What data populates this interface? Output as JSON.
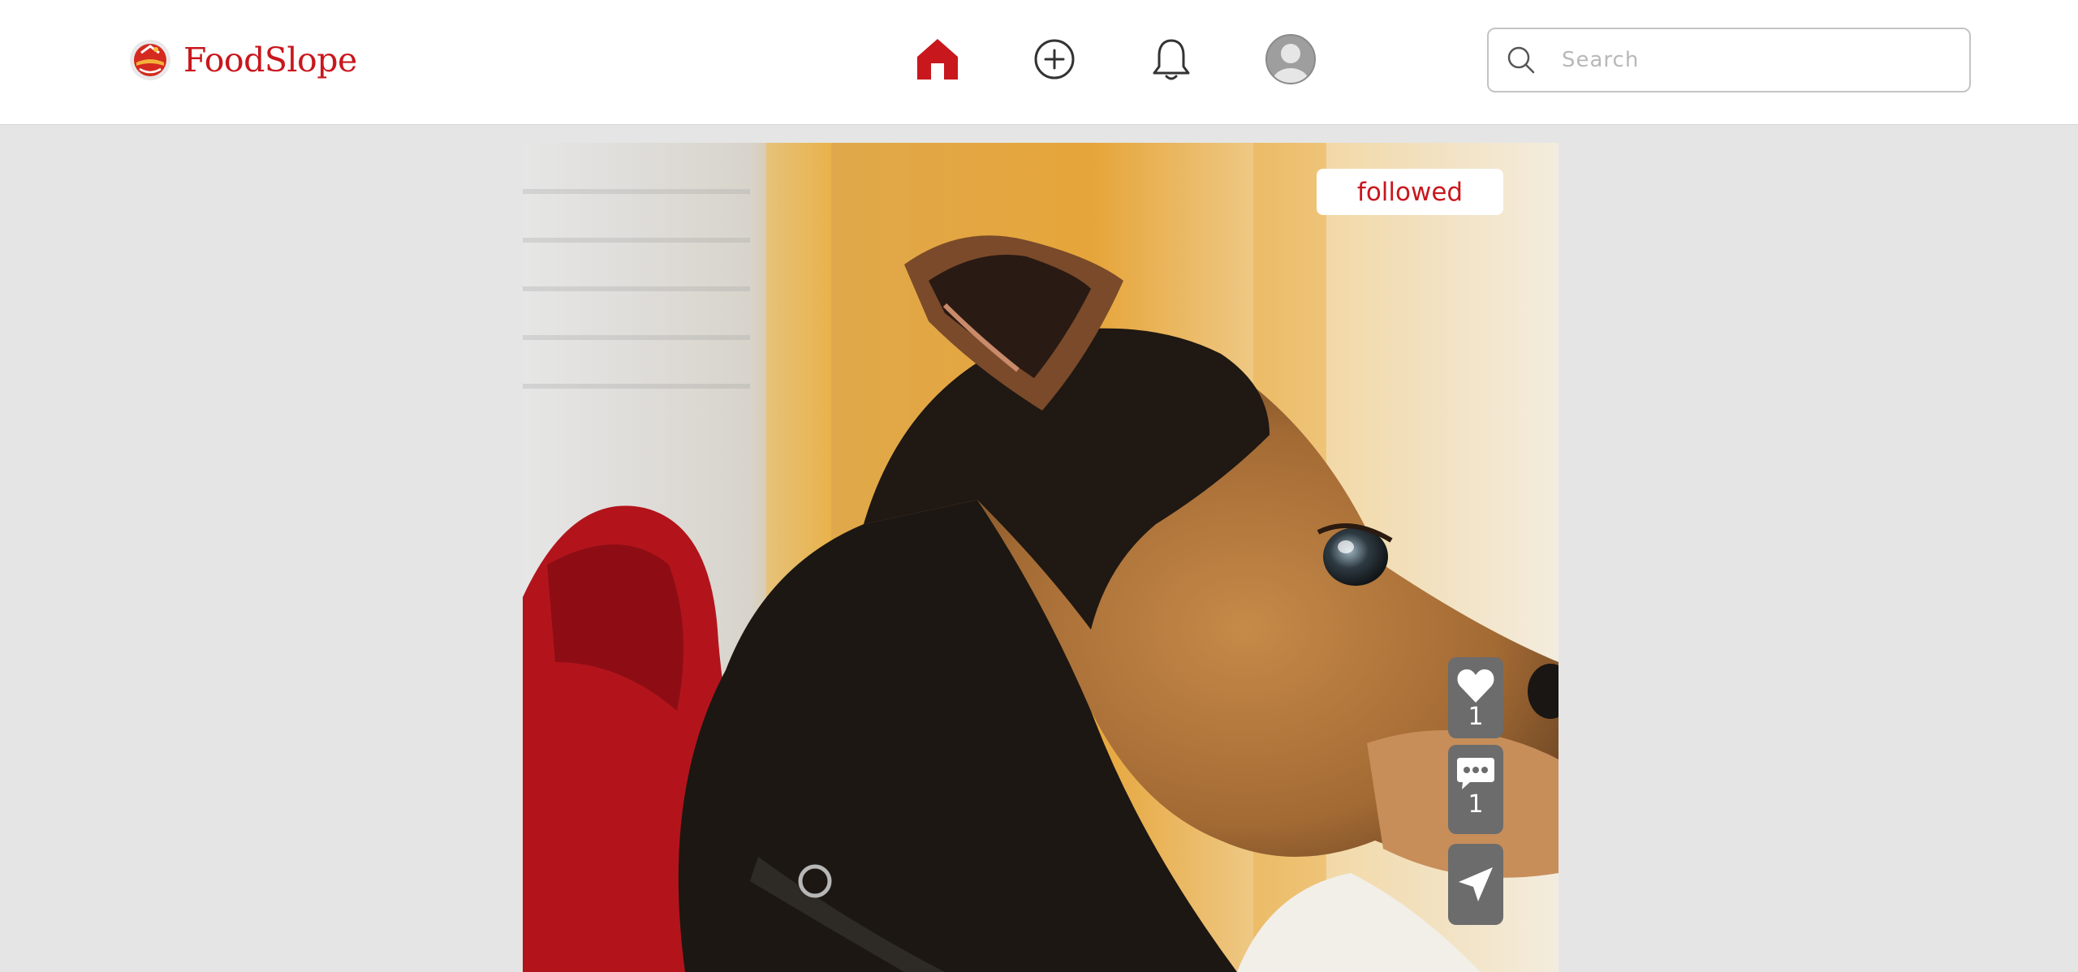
{
  "app": {
    "name": "FoodSlope",
    "brand_color": "#c8171d"
  },
  "nav": {
    "icons": [
      "home-icon",
      "add-circle-icon",
      "bell-icon",
      "profile-avatar-icon"
    ],
    "active": "home"
  },
  "search": {
    "placeholder": "Search",
    "value": ""
  },
  "post": {
    "follow_label": "followed",
    "likes": "1",
    "comments": "1",
    "action_icons": [
      "heart-icon",
      "comment-icon",
      "send-icon"
    ]
  }
}
